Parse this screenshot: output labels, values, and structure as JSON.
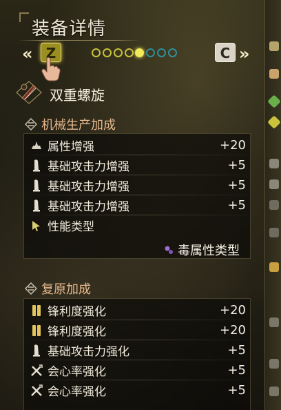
{
  "header": {
    "title": "装备详情",
    "prev_key": "Z",
    "next_key": "C",
    "prev_chevron": "«",
    "next_chevron": "»",
    "page_indicator": {
      "total": 7,
      "active": 4
    }
  },
  "weapon": {
    "name": "双重螺旋",
    "icon": "dual-blades-icon"
  },
  "sections": {
    "machine": {
      "title": "机械生产加成",
      "rows": [
        {
          "icon": "element-icon",
          "label": "属性增强",
          "value": "+20"
        },
        {
          "icon": "attack-icon",
          "label": "基础攻击力增强",
          "value": "+5"
        },
        {
          "icon": "attack-icon",
          "label": "基础攻击力增强",
          "value": "+5"
        },
        {
          "icon": "attack-icon",
          "label": "基础攻击力增强",
          "value": "+5"
        },
        {
          "icon": "performance-icon",
          "label": "性能类型",
          "value": ""
        }
      ],
      "performance_value": "毒属性类型"
    },
    "restore": {
      "title": "复原加成",
      "rows": [
        {
          "icon": "sharpness-icon",
          "label": "锋利度强化",
          "value": "+20"
        },
        {
          "icon": "sharpness-icon",
          "label": "锋利度强化",
          "value": "+20"
        },
        {
          "icon": "attack-icon",
          "label": "基础攻击力强化",
          "value": "+5"
        },
        {
          "icon": "affinity-icon",
          "label": "会心率强化",
          "value": "+5"
        },
        {
          "icon": "affinity-icon",
          "label": "会心率强化",
          "value": "+5"
        }
      ]
    }
  },
  "colors": {
    "section_title": "#e7b98e",
    "dot_yellow": "#c9c23a",
    "dot_teal": "#2e8f9a",
    "key_highlight": "#9a8d22"
  }
}
